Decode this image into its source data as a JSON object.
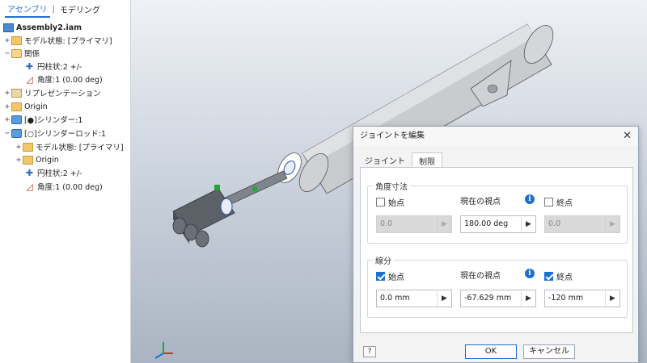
{
  "browser": {
    "tabs": [
      "アセンブリ",
      "モデリング"
    ],
    "tree": [
      {
        "label": "Assembly2.iam",
        "exp": "",
        "icon": "assembly-icon"
      },
      {
        "label": "モデル状態: [プライマリ]",
        "exp": "+",
        "icon": "folder-icon"
      },
      {
        "label": "関係",
        "exp": "−",
        "icon": "folder-open-icon"
      },
      {
        "label": "円柱状:2 +/-",
        "exp": "",
        "icon": "cylindrical-joint-icon"
      },
      {
        "label": "角度:1 (0.00 deg)",
        "exp": "",
        "icon": "angle-constraint-icon"
      },
      {
        "label": "リプレゼンテーション",
        "exp": "+",
        "icon": "representation-icon"
      },
      {
        "label": "Origin",
        "exp": "+",
        "icon": "folder-icon"
      },
      {
        "label": "[●]シリンダー:1",
        "exp": "+",
        "icon": "part-icon"
      },
      {
        "label": "[○]シリンダーロッド:1",
        "exp": "−",
        "icon": "part-icon"
      },
      {
        "label": "モデル状態: [プライマリ]",
        "exp": "+",
        "icon": "folder-icon"
      },
      {
        "label": "Origin",
        "exp": "+",
        "icon": "folder-icon"
      },
      {
        "label": "円柱状:2 +/-",
        "exp": "",
        "icon": "cylindrical-joint-icon"
      },
      {
        "label": "角度:1 (0.00 deg)",
        "exp": "",
        "icon": "angle-constraint-icon"
      }
    ]
  },
  "dialog": {
    "title": "ジョイントを編集",
    "close": "✕",
    "tabs": [
      "ジョイント",
      "制限"
    ],
    "angle_group": "角度寸法",
    "start": "始点",
    "current": "現在の視点",
    "end": "終点",
    "angle_start_value": "0.0",
    "angle_current_value": "180.00 deg",
    "angle_end_value": "0.0",
    "linear_group": "線分",
    "linear_start_value": "0.0 mm",
    "linear_current_value": "-67.629 mm",
    "linear_end_value": "-120 mm",
    "ok": "OK",
    "cancel": "キャンセル",
    "help": "?"
  },
  "colors": {
    "accent": "#1f6fd1"
  }
}
